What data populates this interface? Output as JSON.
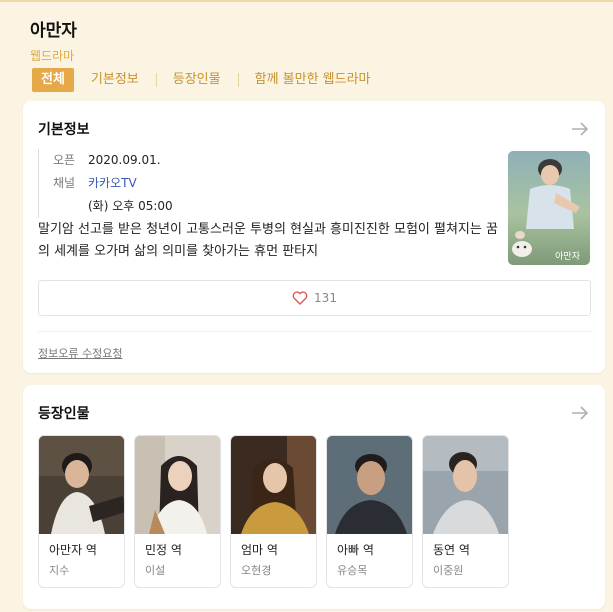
{
  "header": {
    "title": "아만자",
    "subtitle": "웹드라마"
  },
  "tabs": [
    {
      "label": "전체",
      "active": true
    },
    {
      "label": "기본정보"
    },
    {
      "label": "등장인물"
    },
    {
      "label": "함께 볼만한 웹드라마"
    }
  ],
  "info": {
    "title": "기본정보",
    "open_key": "오픈",
    "open_value": "2020.09.01.",
    "channel_key": "채널",
    "channel_value": "카카오TV",
    "schedule": "(화) 오후 05:00",
    "synopsis": "말기암 선고를 받은 청년이 고통스러운 투병의 현실과 흥미진진한 모험이 펼쳐지는 꿈의 세계를 오가며 삶의 의미를 찾아가는 휴먼 판타지",
    "poster_caption": "아만자",
    "likes": "131",
    "report_link": "정보오류 수정요청"
  },
  "characters": {
    "title": "등장인물",
    "items": [
      {
        "role": "아만자 역",
        "actor": "지수"
      },
      {
        "role": "민정 역",
        "actor": "이설"
      },
      {
        "role": "엄마 역",
        "actor": "오현경"
      },
      {
        "role": "아빠 역",
        "actor": "유승목"
      },
      {
        "role": "동연 역",
        "actor": "이중원"
      }
    ]
  },
  "colors": {
    "background": "#fbf4e3",
    "accent": "#e6a947",
    "tab_text": "#c8922d",
    "link": "#3a56b8",
    "heart": "#e05a5a"
  }
}
